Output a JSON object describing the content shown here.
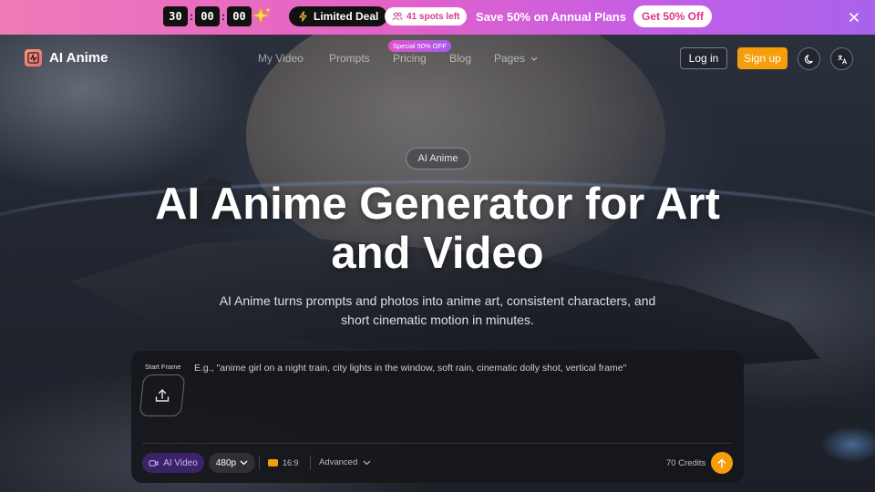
{
  "promo": {
    "timer": [
      "30",
      "00",
      "00"
    ],
    "timer_separator": ":",
    "deal_label": "Limited Deal",
    "spots_label": "41 spots left",
    "save_text": "Save 50% on Annual Plans",
    "cta_label": "Get 50% Off"
  },
  "nav": {
    "brand": "AI Anime",
    "links": [
      "My Video",
      "Prompts",
      "Pricing",
      "Blog",
      "Pages"
    ],
    "pricing_badge": "Special 50% OFF",
    "login_label": "Log in",
    "signup_label": "Sign up"
  },
  "hero": {
    "pill": "AI Anime",
    "title_line1": "AI Anime Generator for Art",
    "title_line2": "and Video",
    "subtitle_line1": "AI Anime turns prompts and photos into anime art, consistent characters, and",
    "subtitle_line2": "short cinematic motion in minutes."
  },
  "composer": {
    "start_frame_label": "Start Frame",
    "prompt_placeholder": "E.g., \"anime girl on a night train, city lights in the window, soft rain, cinematic dolly shot, vertical frame\"",
    "mode_label": "AI Video",
    "resolution": "480p",
    "aspect_ratio": "16:9",
    "advanced_label": "Advanced",
    "credits": "70 Credits"
  },
  "colors": {
    "accent": "#f59e0b",
    "promo_gradient_start": "#f07ab8",
    "promo_gradient_end": "#a862ec"
  }
}
